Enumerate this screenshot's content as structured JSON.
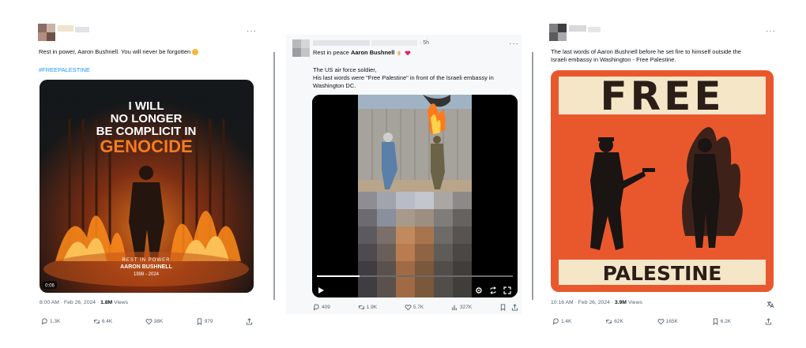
{
  "tweets": [
    {
      "text": "Rest in power, Aaron Bushnell. You will never be forgotten",
      "hashtag": "#FREEPALESTINE",
      "poster_lines": [
        "I WILL",
        "NO LONGER",
        "BE COMPLICIT IN"
      ],
      "poster_highlight": "GENOCIDE",
      "caption_lines": [
        "REST IN POWER",
        "AARON BUSHNELL",
        "1998 - 2024"
      ],
      "video_time": "0:06",
      "timestamp": "8:00 AM · Feb 26, 2024 · ",
      "views": "1.8M",
      "views_label": " Views",
      "actions": {
        "replies": "1.3K",
        "reposts": "6.4K",
        "likes": "38K",
        "bookmarks": "979"
      }
    },
    {
      "time": "· 5h",
      "lead": "Rest in peace ",
      "name": "Aaron Bushnell",
      "line1": "The US air force soldier,",
      "line2": "His last words were \"Free Palestine\" in front of the Israeli embassy in",
      "line3": "Washington DC.",
      "actions": {
        "replies": "409",
        "reposts": "1.9K",
        "likes": "5.7K",
        "views": "327K"
      }
    },
    {
      "text_line1": "The last words of Aaron Bushnell before he set fire to himself outside the",
      "text_line2": "Israeli embassy in Washington - Free Palestine.",
      "poster_top": "FREE",
      "poster_bottom": "PALESTINE",
      "timestamp": "10:16 AM · Feb 26, 2024 · ",
      "views": "3.9M",
      "views_label": " Views",
      "actions": {
        "replies": "1.4K",
        "reposts": "62K",
        "likes": "165K",
        "bookmarks": "6.2K"
      }
    }
  ],
  "colors": {
    "link": "#1d9bf0",
    "muted": "#536471",
    "poster_orange": "#e9582d",
    "poster_cream": "#f4e6c7"
  }
}
